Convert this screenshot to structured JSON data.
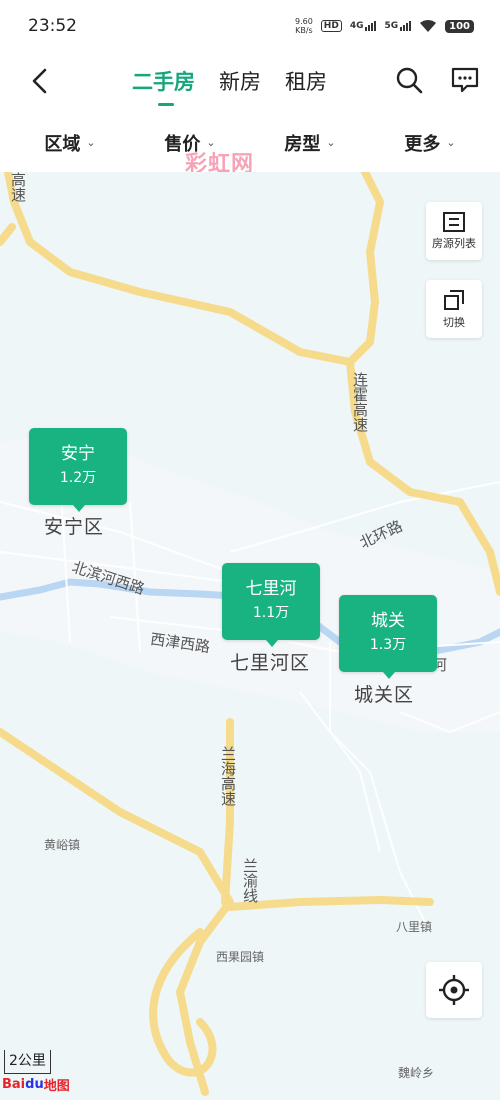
{
  "status_bar": {
    "time": "23:52",
    "net_speed_value": "9.60",
    "net_speed_unit": "KB/s",
    "hd_label": "HD",
    "sig1_label": "4G",
    "sig2_label": "5G",
    "battery": "100"
  },
  "nav": {
    "tabs": [
      {
        "label": "二手房",
        "active": true
      },
      {
        "label": "新房",
        "active": false
      },
      {
        "label": "租房",
        "active": false
      }
    ]
  },
  "filters": [
    {
      "label": "区域"
    },
    {
      "label": "售价"
    },
    {
      "label": "房型"
    },
    {
      "label": "更多"
    }
  ],
  "watermark": "彩虹网",
  "map": {
    "accent_color": "#19b382",
    "road_color": "#f6db8c",
    "river_color": "#b9d6f2",
    "buttons": {
      "list_label": "房源列表",
      "switch_label": "切换"
    },
    "markers": [
      {
        "name": "安宁",
        "price": "1.2万"
      },
      {
        "name": "七里河",
        "price": "1.1万"
      },
      {
        "name": "城关",
        "price": "1.3万"
      }
    ],
    "labels": {
      "gaosu_top": "高速",
      "lianhuo": "连霍高速",
      "anning_qu": "安宁区",
      "beibinhe": "北滨河西路",
      "beihuan": "北环路",
      "xijin": "西津西路",
      "qilihe_qu": "七里河区",
      "chengguan_qu": "城关区",
      "he": "河",
      "lanhai": "兰海高速",
      "huangyu": "黄峪镇",
      "lanyu": "兰渝线",
      "balizhen": "八里镇",
      "xiguoyuan": "西果园镇",
      "weiling": "魏岭乡"
    },
    "scale": "2公里",
    "logo_part1": "Bai",
    "logo_part2": "du",
    "logo_part3": "地图"
  }
}
